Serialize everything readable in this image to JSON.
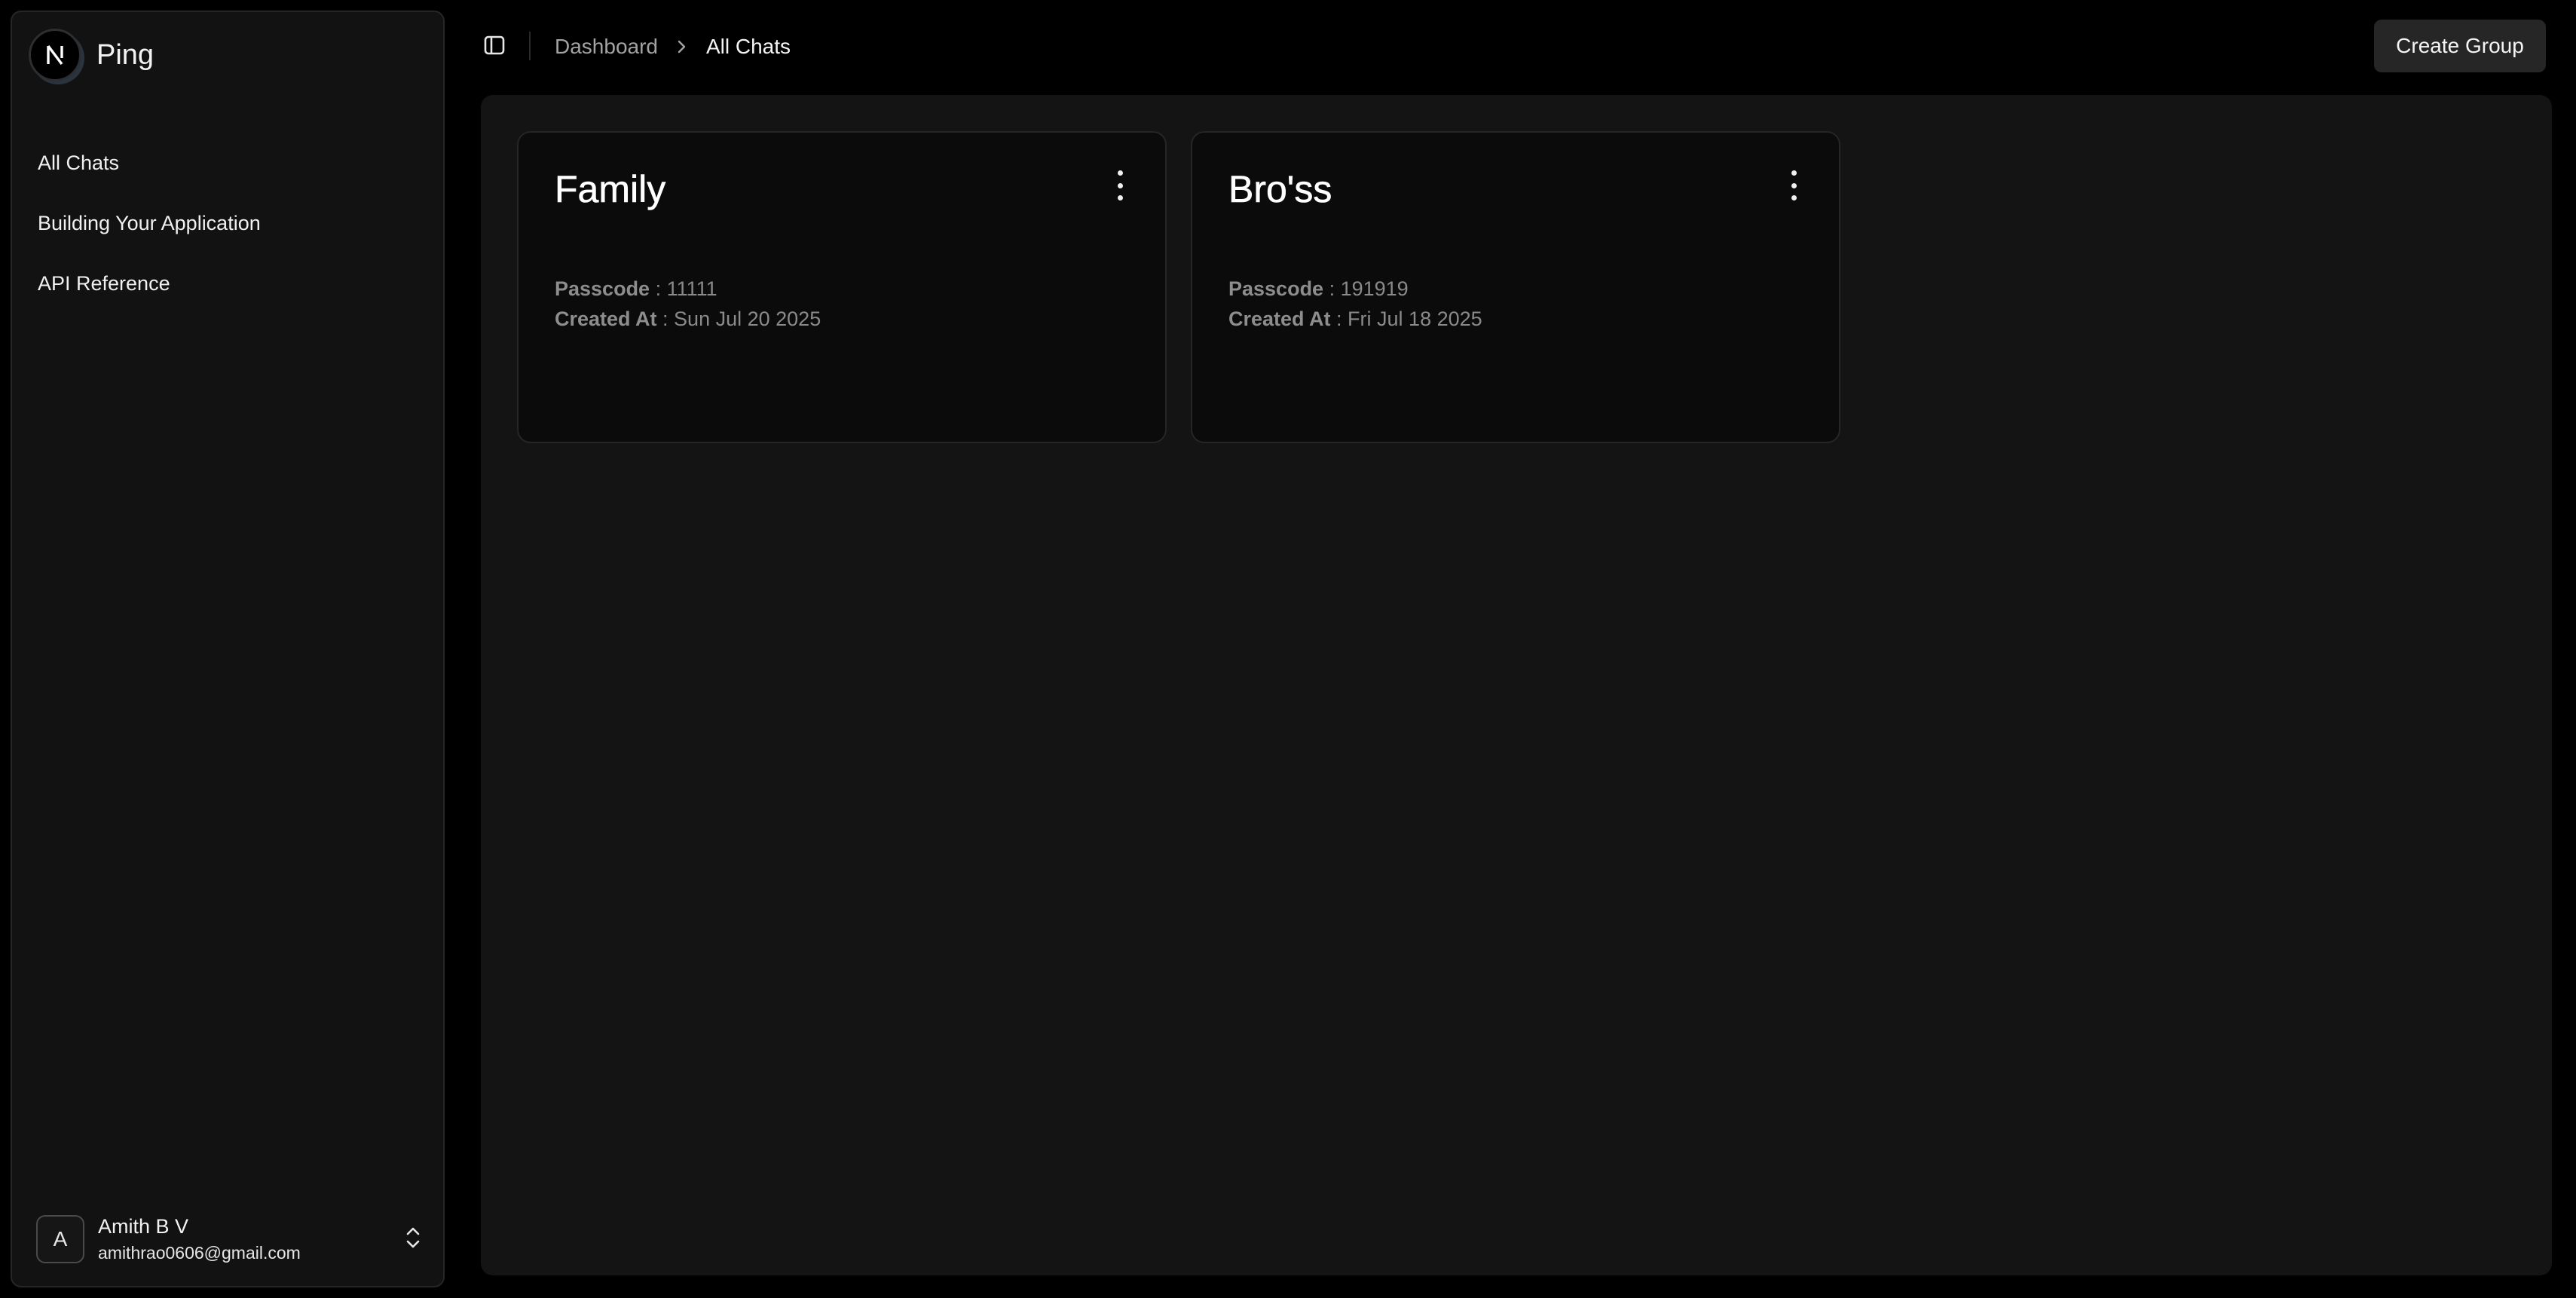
{
  "app": {
    "name": "Ping",
    "logo_letter": "N"
  },
  "sidebar": {
    "items": [
      {
        "label": "All Chats"
      },
      {
        "label": "Building Your Application"
      },
      {
        "label": "API Reference"
      }
    ],
    "user": {
      "avatar_initial": "A",
      "name": "Amith B V",
      "email": "amithrao0606@gmail.com"
    }
  },
  "header": {
    "breadcrumb": [
      "Dashboard",
      "All Chats"
    ],
    "create_button": "Create Group"
  },
  "groups": [
    {
      "title": "Family",
      "passcode_label": "Passcode",
      "separator": " : ",
      "passcode": "11111",
      "created_label": "Created At",
      "created": "Sun Jul 20 2025"
    },
    {
      "title": "Bro'ss",
      "passcode_label": "Passcode",
      "separator": " : ",
      "passcode": "191919",
      "created_label": "Created At",
      "created": "Fri Jul 18 2025"
    }
  ],
  "icons": {
    "sidebar_toggle": "sidebar-toggle-icon",
    "breadcrumb_separator": "chevron-right-icon",
    "card_menu": "more-vertical-icon",
    "user_menu": "chevrons-up-down-icon"
  }
}
